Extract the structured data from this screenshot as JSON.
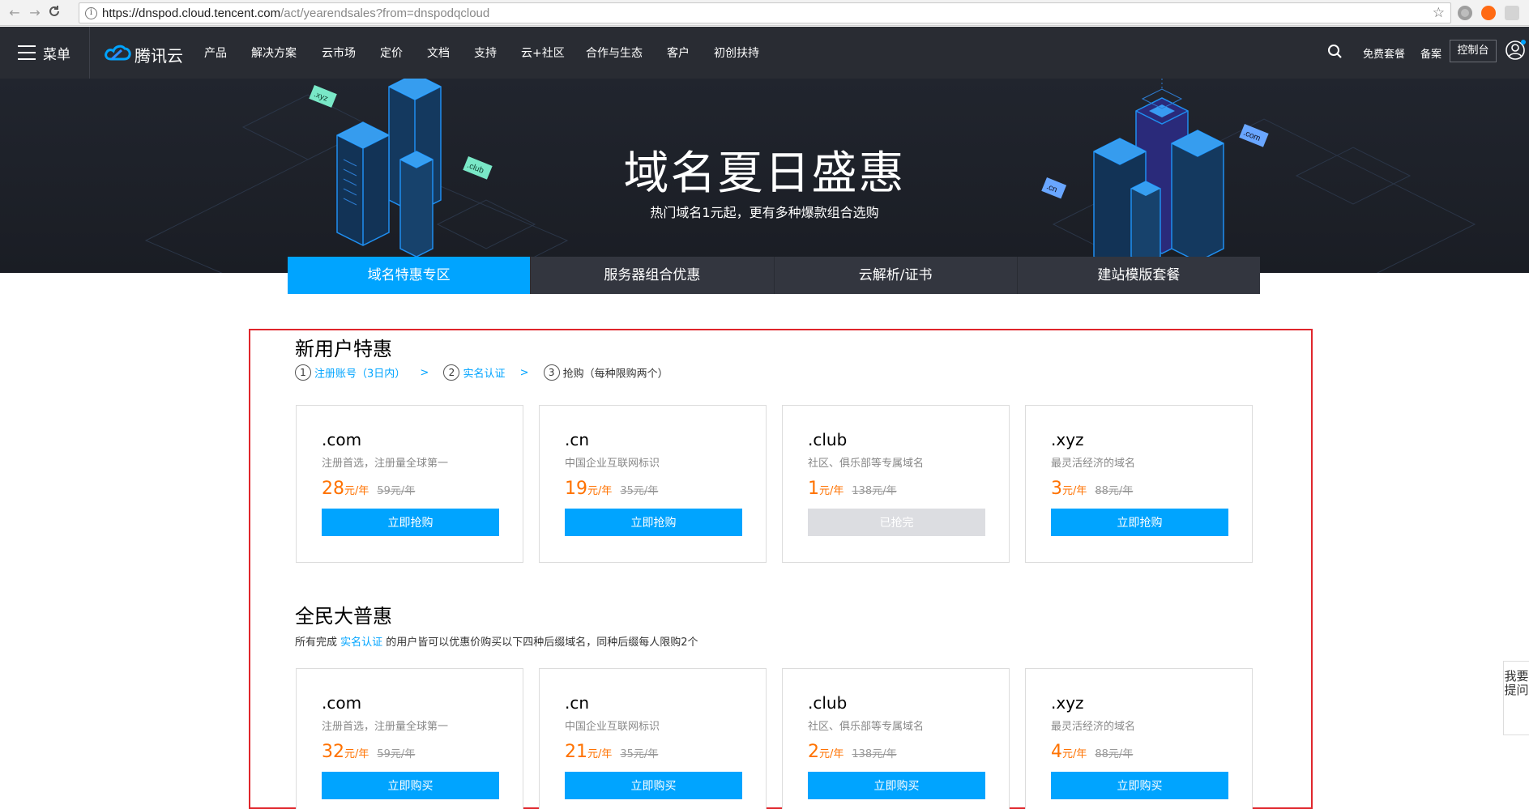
{
  "browser": {
    "url_main": "https://dnspod.cloud.tencent.com",
    "url_rest": "/act/yearendsales?from=dnspodqcloud"
  },
  "header": {
    "menu_label": "菜单",
    "brand": "腾讯云",
    "nav": [
      "产品",
      "解决方案",
      "云市场",
      "定价",
      "文档",
      "支持",
      "云+社区",
      "合作与生态",
      "客户",
      "初创扶持"
    ],
    "free_pkg": "免费套餐",
    "beian": "备案",
    "console": "控制台"
  },
  "hero": {
    "title": "域名夏日盛惠",
    "subtitle": "热门域名1元起，更有多种爆款组合选购",
    "floating_tags": [
      ".xyz",
      ".club",
      ".cn",
      ".com"
    ]
  },
  "tabs": [
    {
      "label": "域名特惠专区",
      "active": true
    },
    {
      "label": "服务器组合优惠",
      "active": false
    },
    {
      "label": "云解析/证书",
      "active": false
    },
    {
      "label": "建站模版套餐",
      "active": false
    }
  ],
  "new_user": {
    "title": "新用户特惠",
    "steps": [
      {
        "num": "1",
        "text": "注册账号（3日内）",
        "link": true
      },
      {
        "num": "2",
        "text": "实名认证",
        "link": true
      },
      {
        "num": "3",
        "text": "抢购（每种限购两个）",
        "link": false
      }
    ],
    "step_sep": ">",
    "cards": [
      {
        "ext": ".com",
        "tag": "注册首选，注册量全球第一",
        "price": "28",
        "unit": "元/年",
        "orig": "59元/年",
        "button": "立即抢购",
        "disabled": false
      },
      {
        "ext": ".cn",
        "tag": "中国企业互联网标识",
        "price": "19",
        "unit": "元/年",
        "orig": "35元/年",
        "button": "立即抢购",
        "disabled": false
      },
      {
        "ext": ".club",
        "tag": "社区、俱乐部等专属域名",
        "price": "1",
        "unit": "元/年",
        "orig": "138元/年",
        "button": "已抢完",
        "disabled": true
      },
      {
        "ext": ".xyz",
        "tag": "最灵活经济的域名",
        "price": "3",
        "unit": "元/年",
        "orig": "88元/年",
        "button": "立即抢购",
        "disabled": false
      }
    ]
  },
  "all_users": {
    "title": "全民大普惠",
    "desc_before": "所有完成 ",
    "desc_link": "实名认证",
    "desc_after": " 的用户皆可以优惠价购买以下四种后缀域名，同种后缀每人限购2个",
    "cards": [
      {
        "ext": ".com",
        "tag": "注册首选，注册量全球第一",
        "price": "32",
        "unit": "元/年",
        "orig": "59元/年",
        "button": "立即购买",
        "disabled": false
      },
      {
        "ext": ".cn",
        "tag": "中国企业互联网标识",
        "price": "21",
        "unit": "元/年",
        "orig": "35元/年",
        "button": "立即购买",
        "disabled": false
      },
      {
        "ext": ".club",
        "tag": "社区、俱乐部等专属域名",
        "price": "2",
        "unit": "元/年",
        "orig": "138元/年",
        "button": "立即购买",
        "disabled": false
      },
      {
        "ext": ".xyz",
        "tag": "最灵活经济的域名",
        "price": "4",
        "unit": "元/年",
        "orig": "88元/年",
        "button": "立即购买",
        "disabled": false
      }
    ]
  },
  "side_float": "我要提问",
  "colors": {
    "accent": "#00a4ff",
    "price": "#ff7200",
    "header_bg": "#292c33",
    "highlight_border": "#e0262c"
  }
}
